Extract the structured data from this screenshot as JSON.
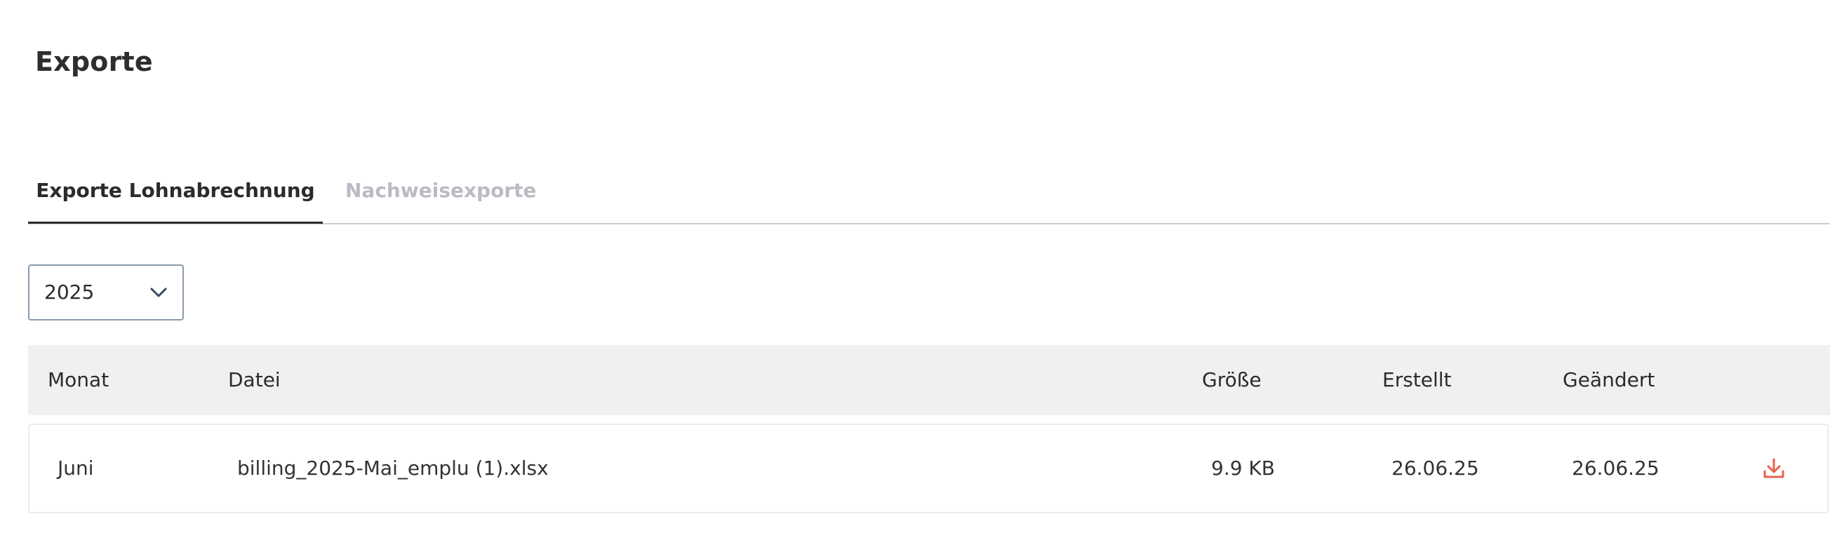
{
  "page": {
    "title": "Exporte"
  },
  "tabs": [
    {
      "label": "Exporte Lohnabrechnung",
      "active": true
    },
    {
      "label": "Nachweisexporte",
      "active": false
    }
  ],
  "year_filter": {
    "selected": "2025",
    "icon": "chevron-down-icon"
  },
  "table": {
    "columns": [
      "Monat",
      "Datei",
      "Größe",
      "Erstellt",
      "Geändert"
    ],
    "rows": [
      {
        "month": "Juni",
        "file": "billing_2025-Mai_emplu (1).xlsx",
        "size": "9.9 KB",
        "created": "26.06.25",
        "modified": "26.06.25",
        "action_icon": "download-icon"
      }
    ]
  },
  "colors": {
    "accent_download": "#e8624f",
    "header_bg": "#f0f0f0",
    "tab_inactive": "#b9bcc2",
    "border": "#c9ced6"
  }
}
